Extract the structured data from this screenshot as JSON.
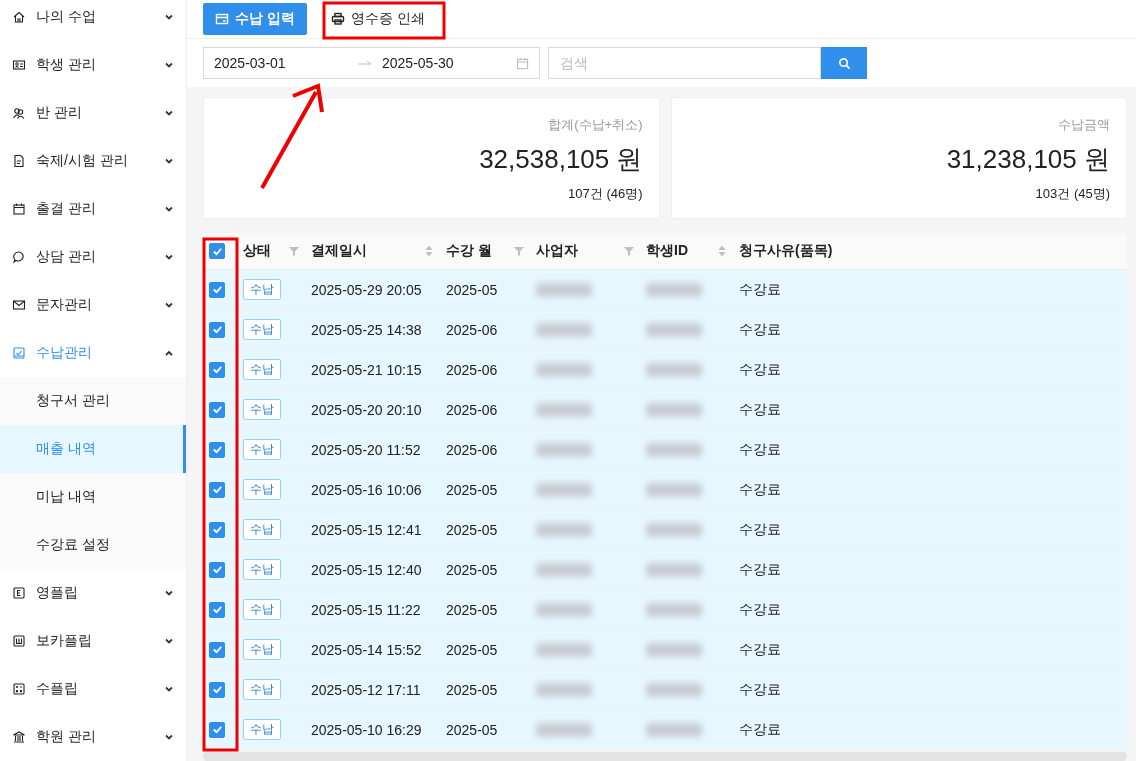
{
  "sidebar": {
    "items": [
      {
        "label": "나의 수업",
        "expanded": false
      },
      {
        "label": "학생 관리",
        "expanded": false
      },
      {
        "label": "반 관리",
        "expanded": false
      },
      {
        "label": "숙제/시험 관리",
        "expanded": false
      },
      {
        "label": "출결 관리",
        "expanded": false
      },
      {
        "label": "상담 관리",
        "expanded": false
      },
      {
        "label": "문자관리",
        "expanded": false
      },
      {
        "label": "수납관리",
        "expanded": true,
        "children": [
          {
            "label": "청구서 관리",
            "selected": false
          },
          {
            "label": "매출 내역",
            "selected": true
          },
          {
            "label": "미납 내역",
            "selected": false
          },
          {
            "label": "수강료 설정",
            "selected": false
          }
        ]
      },
      {
        "label": "영플립",
        "expanded": false
      },
      {
        "label": "보카플립",
        "expanded": false
      },
      {
        "label": "수플립",
        "expanded": false
      },
      {
        "label": "학원 관리",
        "expanded": false
      }
    ]
  },
  "toolbar": {
    "buttons": [
      {
        "label": "수납 입력",
        "kind": "primary"
      },
      {
        "label": "영수증 인쇄",
        "kind": "default"
      }
    ]
  },
  "filter": {
    "date_from": "2025-03-01",
    "date_to": "2025-05-30",
    "search": {
      "placeholder": "검색"
    }
  },
  "summary_cards": [
    {
      "title": "합계(수납+취소)",
      "amount": "32,538,105 원",
      "count": "107건 (46명)"
    },
    {
      "title": "수납금액",
      "amount": "31,238,105 원",
      "count": "103건 (45명)"
    }
  ],
  "table": {
    "all_checked": true,
    "columns": [
      {
        "label": "상태",
        "filterable": true,
        "sortable": false
      },
      {
        "label": "결제일시",
        "filterable": false,
        "sortable": true
      },
      {
        "label": "수강 월",
        "filterable": true,
        "sortable": false
      },
      {
        "label": "사업자",
        "filterable": true,
        "sortable": false
      },
      {
        "label": "학생ID",
        "filterable": false,
        "sortable": true
      },
      {
        "label": "청구사유(품목)",
        "filterable": false,
        "sortable": false
      }
    ],
    "rows": [
      {
        "checked": true,
        "status": "수납",
        "paid_at": "2025-05-29 20:05",
        "month": "2025-05",
        "reason": "수강료"
      },
      {
        "checked": true,
        "status": "수납",
        "paid_at": "2025-05-25 14:38",
        "month": "2025-06",
        "reason": "수강료"
      },
      {
        "checked": true,
        "status": "수납",
        "paid_at": "2025-05-21 10:15",
        "month": "2025-06",
        "reason": "수강료"
      },
      {
        "checked": true,
        "status": "수납",
        "paid_at": "2025-05-20 20:10",
        "month": "2025-06",
        "reason": "수강료"
      },
      {
        "checked": true,
        "status": "수납",
        "paid_at": "2025-05-20 11:52",
        "month": "2025-06",
        "reason": "수강료"
      },
      {
        "checked": true,
        "status": "수납",
        "paid_at": "2025-05-16 10:06",
        "month": "2025-05",
        "reason": "수강료"
      },
      {
        "checked": true,
        "status": "수납",
        "paid_at": "2025-05-15 12:41",
        "month": "2025-05",
        "reason": "수강료"
      },
      {
        "checked": true,
        "status": "수납",
        "paid_at": "2025-05-15 12:40",
        "month": "2025-05",
        "reason": "수강료"
      },
      {
        "checked": true,
        "status": "수납",
        "paid_at": "2025-05-15 11:22",
        "month": "2025-05",
        "reason": "수강료"
      },
      {
        "checked": true,
        "status": "수납",
        "paid_at": "2025-05-14 15:52",
        "month": "2025-05",
        "reason": "수강료"
      },
      {
        "checked": true,
        "status": "수납",
        "paid_at": "2025-05-12 17:11",
        "month": "2025-05",
        "reason": "수강료"
      },
      {
        "checked": true,
        "status": "수납",
        "paid_at": "2025-05-10 16:29",
        "month": "2025-05",
        "reason": "수강료"
      }
    ]
  }
}
